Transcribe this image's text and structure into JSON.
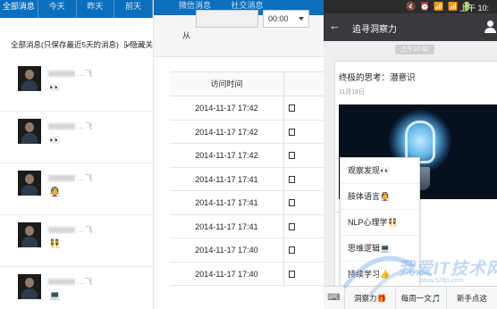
{
  "left": {
    "tabs": [
      "全部消息",
      "今天",
      "昨天",
      "前天"
    ],
    "header_text": "全部消息(只保存最近5天的消息)",
    "hide_label": "隐藏关",
    "messages": [
      {
        "nick": "…飞",
        "emoji": "👀"
      },
      {
        "nick": "…飞",
        "emoji": "👀"
      },
      {
        "nick": "…飞",
        "emoji": "👰"
      },
      {
        "nick": "…飞",
        "emoji": "👯"
      },
      {
        "nick": "…飞",
        "emoji": "💻"
      }
    ]
  },
  "middle": {
    "top_tabs": [
      "微信消息",
      "社交消息"
    ],
    "filter_from_label": "从",
    "time_value": "00:00",
    "column_header": "访问时间",
    "rows": [
      "2014-11-17 17:42",
      "2014-11-17 17:42",
      "2014-11-17 17:42",
      "2014-11-17 17:41",
      "2014-11-17 17:41",
      "2014-11-17 17:41",
      "2014-11-17 17:40",
      "2014-11-17 17:40"
    ]
  },
  "phone": {
    "status_time": "上午 10:",
    "status_icons": "🔇 ⏰ 📶 📶 🔋",
    "title": "追寻洞察力",
    "time_pill": "上午10:42",
    "card_title": "终极的思考：潜意识",
    "card_date": "11月18日",
    "menu": [
      "观察发现👀",
      "肢体语言👰",
      "NLP心理学👯",
      "思维逻辑💻",
      "持续学习👍"
    ],
    "bottom_nav": [
      "洞察力🎁",
      "每周一文🎵",
      "新手点这"
    ],
    "keyboard_icon": "⌨"
  },
  "watermark": {
    "text": "我爱IT技术网",
    "url": "www.52itjs.com"
  }
}
